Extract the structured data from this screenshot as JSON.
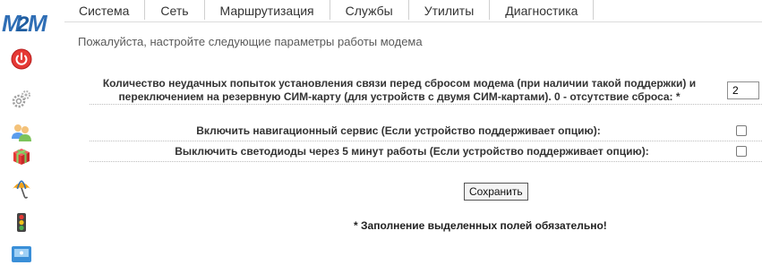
{
  "logo": {
    "text_m": "M",
    "text_2": "2",
    "text_m2": "M"
  },
  "sidebar": {
    "icons": [
      {
        "name": "power-icon",
        "color": "#e53935"
      },
      {
        "name": "gear-icon",
        "color": "#9e9e9e"
      },
      {
        "name": "users-icon",
        "color": "#5c9ded"
      },
      {
        "name": "gift-icon",
        "color": "#e53935"
      },
      {
        "name": "umbrella-icon",
        "color": "#f2a31b"
      },
      {
        "name": "traffic-light-icon",
        "color": "#444444"
      },
      {
        "name": "network-icon",
        "color": "#3a8fd8"
      }
    ]
  },
  "topmenu": {
    "tabs": [
      {
        "label": "Система"
      },
      {
        "label": "Сеть"
      },
      {
        "label": "Маршрутизация"
      },
      {
        "label": "Службы"
      },
      {
        "label": "Утилиты"
      },
      {
        "label": "Диагностика"
      }
    ]
  },
  "page": {
    "subtitle": "Пожалуйста, настройте следующие параметры работы модема"
  },
  "form": {
    "retry_label_line1": "Количество неудачных попыток установления связи перед сбросом модема (при наличии такой поддержки) и",
    "retry_label_line2": "переключением на резервную СИМ-карту (для устройств с двумя СИМ-картами). 0 - отсутствие сброса: *",
    "retry_value": "2",
    "nav_label": "Включить навигационный сервис (Если устройство поддерживает опцию):",
    "nav_checked": false,
    "leds_label": "Выключить светодиоды через 5 минут работы (Если устройство поддерживает опцию):",
    "leds_checked": false,
    "save_label": "Сохранить",
    "required_note": "* Заполнение выделенных полей обязательно!"
  }
}
